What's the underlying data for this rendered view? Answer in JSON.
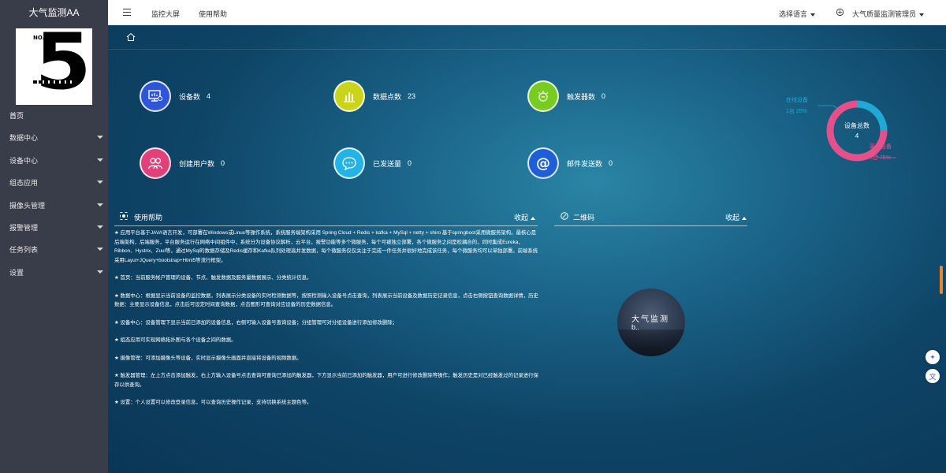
{
  "app": {
    "title": "大气监测AA"
  },
  "sidebar": {
    "items": [
      {
        "label": "首页"
      },
      {
        "label": "数据中心"
      },
      {
        "label": "设备中心"
      },
      {
        "label": "组态应用"
      },
      {
        "label": "摄像头管理"
      },
      {
        "label": "报警管理"
      },
      {
        "label": "任务列表"
      },
      {
        "label": "设置"
      }
    ]
  },
  "topbar": {
    "links": [
      {
        "label": "监控大屏"
      },
      {
        "label": "使用帮助"
      }
    ],
    "language": "选择语言",
    "user": "大气质量监测管理员"
  },
  "stats": [
    {
      "label": "设备数",
      "value": "4",
      "color": "#2f56d8",
      "icon": "monitor-icon"
    },
    {
      "label": "数据点数",
      "value": "23",
      "color": "#c9d41a",
      "icon": "bar-chart-icon"
    },
    {
      "label": "触发器数",
      "value": "0",
      "color": "#78cc21",
      "icon": "trigger-icon"
    },
    {
      "label": "创建用户数",
      "value": "0",
      "color": "#e2407a",
      "icon": "users-icon"
    },
    {
      "label": "已发送量",
      "value": "0",
      "color": "#22b4e6",
      "icon": "chat-icon"
    },
    {
      "label": "邮件发送数",
      "value": "0",
      "color": "#1f5fd6",
      "icon": "at-icon"
    }
  ],
  "chart_data": {
    "type": "pie",
    "title": "设备总数",
    "center_value": "4",
    "series": [
      {
        "name": "在线设备",
        "count_label": "1台",
        "percent_label": "25%",
        "value": 1,
        "color": "#20a9d6"
      },
      {
        "name": "离线设备",
        "count_label": "3台",
        "percent_label": "75%",
        "value": 3,
        "color": "#e6508a"
      }
    ]
  },
  "help_panel": {
    "title": "使用帮助",
    "collapse_label": "收起",
    "paragraphs": [
      "★ 应用平台基于JAVA语言开发，可部署在Windows或Linux等操作系统，系统服务端架构采用 Spring Cloud + Redis + kafka + MySql + netty + shiro 基于springboot采用微服务架构。最核心是后端架构，后端服务，平台服务运行在网络中间组件中，系统分为设备协议解析，云平台，报警功能等多个微服务，每个可被独立部署，各个微服务之间是松耦合的，同时集成Eureka、Ribbon、Hystrix、Zuul等，通过MySql的数据存储及Redis缓存和Kafka队列处理高并发数据，每个微服务仅仅关注于完成一件任务并很好地完成该任务，每个微服务均可以单独部署。前端系统采用Layui+JQuery+bootstrap+Html5等流行框架。",
      "★ 首页：当前服务帐户管理的设备、节点、触发数据及服务量数据展示、分类统计信息。",
      "★ 数据中心：根据显示当前设备的监控数据，列表展示分类设备的实时检测数据等，按照检测输入设备号点击查询，列表展示当前设备及数据历史记录信息，点击右侧按钮查询数据详情，历史数据：主要显示设备信息，点击后可设定时间查询数据，点击图形可查询对应设备的历史数据信息。",
      "★ 设备中心：设备管理下显示当前已添加的设备信息，右侧可输入设备号查询设备；分组管理可对分组设备进行添加修改删除；",
      "★ 组态应用可实现网络拓扑图与各个设备之间的数据。",
      "★ 摄像管理：可添加摄像头等设备，实时显示摄像头画面并直接将设备的视频数据。",
      "★ 触发器管理：左上方点击添加触发，右上方输入设备号点击查询可查询已添加的触发器，下方显示当前已添加的触发器，用户可进行修改删除等操作；触发历史是对已经触发过的记录进行保存以供查询。",
      "★ 设置：个人设置可以修改登录信息，可以查询历史操作记录，支持切换系统主题色等。"
    ]
  },
  "qr_panel": {
    "title": "二维码",
    "collapse_label": "收起",
    "image_text": "大气监测",
    "image_subtext": "b.."
  },
  "float_buttons": [
    {
      "icon": "sparkle-icon"
    },
    {
      "icon": "translate-icon"
    }
  ]
}
